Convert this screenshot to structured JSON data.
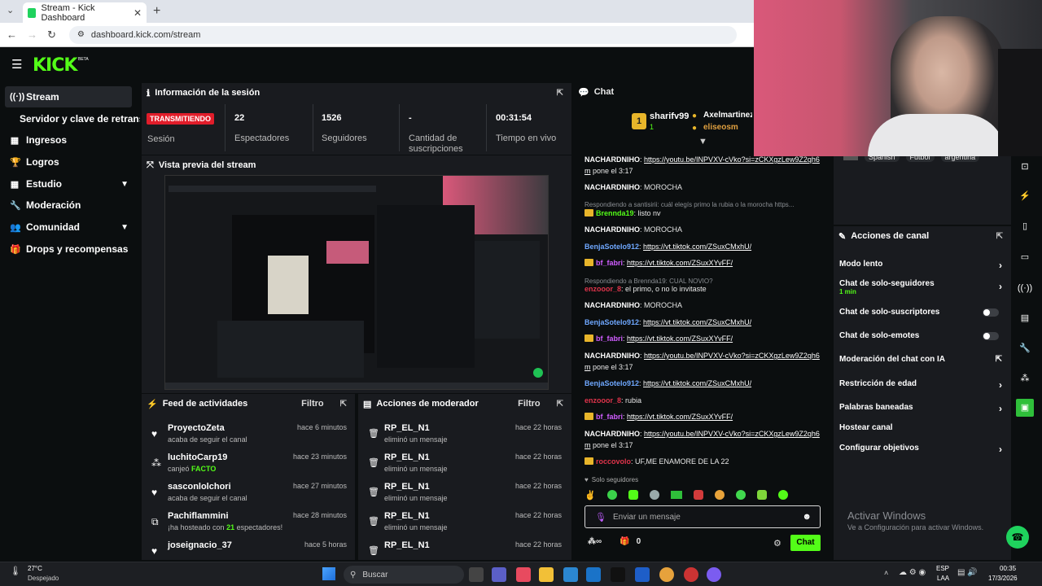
{
  "browser": {
    "tab_title": "Stream - Kick Dashboard",
    "url": "dashboard.kick.com/stream"
  },
  "brand": {
    "logo": "KICK",
    "beta": "BETA",
    "accent": "#53fc18"
  },
  "sidebar": {
    "items": [
      {
        "label": "Stream",
        "icon": "broadcast-icon"
      },
      {
        "label": "Servidor y clave de retransmisión",
        "icon": ""
      },
      {
        "label": "Ingresos",
        "icon": "grid-icon"
      },
      {
        "label": "Logros",
        "icon": "trophy-icon"
      },
      {
        "label": "Estudio",
        "icon": "grid-icon"
      },
      {
        "label": "Moderación",
        "icon": "wrench-icon"
      },
      {
        "label": "Comunidad",
        "icon": "people-icon"
      },
      {
        "label": "Drops y recompensas",
        "icon": "gift-icon"
      }
    ]
  },
  "session": {
    "title": "Información de la sesión",
    "status": "TRANSMITIENDO",
    "status_label": "Sesión",
    "stats": [
      {
        "value": "22",
        "label": "Espectadores"
      },
      {
        "value": "1526",
        "label": "Seguidores"
      },
      {
        "value": "-",
        "label": "Cantidad de suscripciones"
      },
      {
        "value": "00:31:54",
        "label": "Tiempo en vivo"
      }
    ]
  },
  "preview": {
    "title": "Vista previa del stream"
  },
  "feed": {
    "title": "Feed de actividades",
    "filter": "Filtro",
    "rows": [
      {
        "name": "ProyectoZeta",
        "sub": "acaba de seguir el canal",
        "time": "hace 6 minutos",
        "icon": "heart-icon"
      },
      {
        "name": "luchitoCarp19",
        "sub_pre": "canjeó ",
        "sub_hl": "FACTO",
        "time": "hace 23 minutos",
        "icon": "kick-points-icon"
      },
      {
        "name": "sasconlolchori",
        "sub": "acaba de seguir el canal",
        "time": "hace 27 minutos",
        "icon": "heart-icon"
      },
      {
        "name": "Pachiflammini",
        "sub_pre": "¡ha hosteado con ",
        "sub_hl": "21",
        "sub_post": " espectadores!",
        "time": "hace 28 minutos",
        "icon": "host-icon"
      },
      {
        "name": "joseignacio_37",
        "time": "hace 5 horas",
        "icon": "heart-icon"
      }
    ]
  },
  "mod": {
    "title": "Acciones de moderador",
    "filter": "Filtro",
    "rows": [
      {
        "name": "RP_EL_N1",
        "sub": "eliminó un mensaje",
        "time": "hace 22 horas"
      },
      {
        "name": "RP_EL_N1",
        "sub": "eliminó un mensaje",
        "time": "hace 22 horas"
      },
      {
        "name": "RP_EL_N1",
        "sub": "eliminó un mensaje",
        "time": "hace 22 horas"
      },
      {
        "name": "RP_EL_N1",
        "sub": "eliminó un mensaje",
        "time": "hace 22 horas"
      },
      {
        "name": "RP_EL_N1",
        "sub": "eliminó un mensaje",
        "time": "hace 22 horas"
      }
    ]
  },
  "chat": {
    "title": "Chat",
    "top": [
      {
        "name": "sharifv99",
        "rank": "1",
        "count": "1"
      },
      {
        "name": "Axelmartinez"
      },
      {
        "name": "eliseosm"
      }
    ],
    "messages": [
      {
        "user": "NACHARDNIHO",
        "color": "#ffffff",
        "text": "https://youtu.be/INPVXV-cVko?si=zCKXgzLew9Z2qh6m",
        "after": " pone el 3:17"
      },
      {
        "user": "NACHARDNIHO",
        "color": "#ffffff",
        "text": "MOROCHA"
      },
      {
        "reply": "Respondiendo a santisirii: cuál elegís primo la rubia o la morocha https..."
      },
      {
        "user": "Brennda19",
        "color": "#53fc18",
        "text": "listo nv",
        "crown": true
      },
      {
        "user": "NACHARDNIHO",
        "color": "#ffffff",
        "text": "MOROCHA"
      },
      {
        "user": "BenjaSotelo912",
        "color": "#6fa8ff",
        "text": "https://vt.tiktok.com/ZSuxCMxhU/"
      },
      {
        "user": "bf_fabri",
        "color": "#d05dff",
        "text": "https://vt.tiktok.com/ZSuxXYvFF/",
        "crown": true
      },
      {
        "reply": "Respondiendo a Brennda19: CUAL NOVIO?"
      },
      {
        "user": "enzooor_8",
        "color": "#e0344b",
        "text": "el primo, o no lo invitaste"
      },
      {
        "user": "NACHARDNIHO",
        "color": "#ffffff",
        "text": "MOROCHA"
      },
      {
        "user": "BenjaSotelo912",
        "color": "#6fa8ff",
        "text": "https://vt.tiktok.com/ZSuxCMxhU/"
      },
      {
        "user": "bf_fabri",
        "color": "#d05dff",
        "text": "https://vt.tiktok.com/ZSuxXYvFF/",
        "crown": true
      },
      {
        "user": "NACHARDNIHO",
        "color": "#ffffff",
        "text": "https://youtu.be/INPVXV-cVko?si=zCKXgzLew9Z2qh6m",
        "after": " pone el 3:17"
      },
      {
        "user": "BenjaSotelo912",
        "color": "#6fa8ff",
        "text": "https://vt.tiktok.com/ZSuxCMxhU/"
      },
      {
        "user": "enzooor_8",
        "color": "#e0344b",
        "text": "rubia"
      },
      {
        "user": "bf_fabri",
        "color": "#d05dff",
        "text": "https://vt.tiktok.com/ZSuxXYvFF/",
        "crown": true
      },
      {
        "user": "NACHARDNIHO",
        "color": "#ffffff",
        "text": "https://youtu.be/INPVXV-cVko?si=zCKXgzLew9Z2qh6m",
        "after": " pone el 3:17"
      },
      {
        "user": "roccovolo",
        "color": "#e0344b",
        "text": "UF,ME ENAMORE DE LA 22",
        "crown": true
      }
    ],
    "followers_only": "Solo seguidores",
    "input_placeholder": "Enviar un mensaje",
    "points": "0",
    "send_label": "Chat"
  },
  "tags": [
    "Spanish",
    "Futbol",
    "argentina"
  ],
  "actions": {
    "title": "Acciones de canal",
    "items": [
      {
        "label": "Modo lento",
        "type": "arrow"
      },
      {
        "label": "Chat de solo-seguidores",
        "sub": "1 min",
        "type": "arrow"
      },
      {
        "label": "Chat de solo-suscriptores",
        "type": "toggle"
      },
      {
        "label": "Chat de solo-emotes",
        "type": "toggle"
      },
      {
        "label": "Moderación del chat con IA",
        "type": "external"
      },
      {
        "label": "Restricción de edad",
        "type": "arrow"
      },
      {
        "label": "Palabras baneadas",
        "type": "arrow"
      },
      {
        "label": "Hostear canal",
        "type": "none"
      },
      {
        "label": "Configurar objetivos",
        "type": "arrow"
      }
    ]
  },
  "windows": {
    "activate_title": "Activar Windows",
    "activate_sub": "Ve a Configuración para activar Windows.",
    "weather_temp": "27°C",
    "weather_desc": "Despejado",
    "search": "Buscar",
    "lang": "ESP",
    "lang2": "LAA",
    "time": "00:35",
    "date": "17/3/2026"
  }
}
